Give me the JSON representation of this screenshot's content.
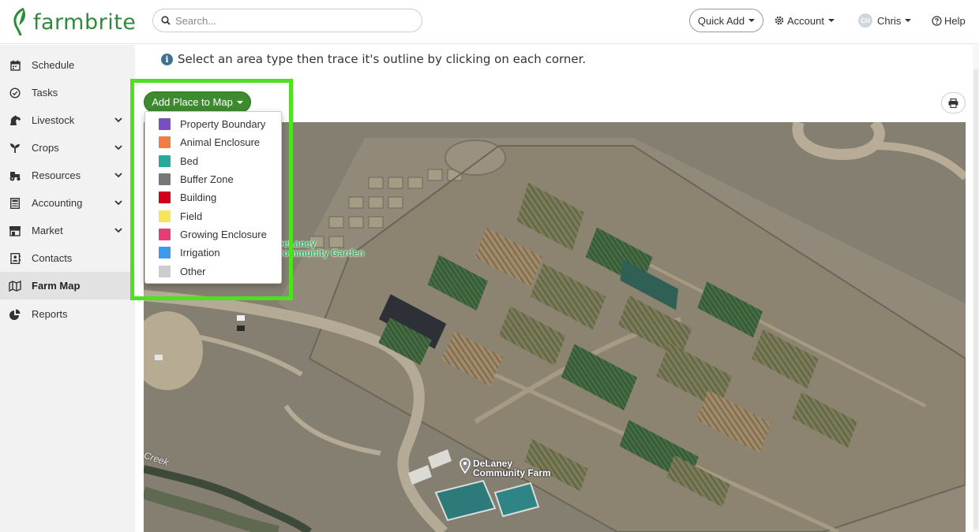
{
  "app": {
    "name": "farmbrite"
  },
  "header": {
    "search_placeholder": "Search...",
    "quick_add_label": "Quick Add",
    "account_label": "Account",
    "user_initials": "CH",
    "user_name": "Chris",
    "help_label": "Help"
  },
  "sidebar": {
    "items": [
      {
        "label": "Schedule",
        "icon": "calendar-icon",
        "expandable": false
      },
      {
        "label": "Tasks",
        "icon": "check-circle-icon",
        "expandable": false
      },
      {
        "label": "Livestock",
        "icon": "horse-icon",
        "expandable": true
      },
      {
        "label": "Crops",
        "icon": "seedling-icon",
        "expandable": true
      },
      {
        "label": "Resources",
        "icon": "tractor-icon",
        "expandable": true
      },
      {
        "label": "Accounting",
        "icon": "calculator-icon",
        "expandable": true
      },
      {
        "label": "Market",
        "icon": "store-icon",
        "expandable": true
      },
      {
        "label": "Contacts",
        "icon": "address-book-icon",
        "expandable": false
      },
      {
        "label": "Farm Map",
        "icon": "map-icon",
        "expandable": false,
        "active": true
      },
      {
        "label": "Reports",
        "icon": "pie-chart-icon",
        "expandable": false
      }
    ]
  },
  "main": {
    "instruction": "Select an area type then trace it's outline by clicking on each corner.",
    "add_place_label": "Add Place to Map",
    "area_types": [
      {
        "label": "Property Boundary",
        "color": "#7a4fc1"
      },
      {
        "label": "Animal Enclosure",
        "color": "#f07c4a"
      },
      {
        "label": "Bed",
        "color": "#2aa89a"
      },
      {
        "label": "Buffer Zone",
        "color": "#777777"
      },
      {
        "label": "Building",
        "color": "#d0021b"
      },
      {
        "label": "Field",
        "color": "#f8e45c"
      },
      {
        "label": "Growing Enclosure",
        "color": "#e63d77"
      },
      {
        "label": "Irrigation",
        "color": "#3d9be9"
      },
      {
        "label": "Other",
        "color": "#cccccc"
      }
    ],
    "map_labels": {
      "garden_line1": "DeLaney",
      "garden_line2": "Community Garden",
      "farm_line1": "DeLaney",
      "farm_line2": "Community Farm",
      "creek": "Creek"
    }
  },
  "colors": {
    "brand": "#2e8b3a",
    "button_green": "#3e8a2f",
    "highlight": "#4fe01f"
  }
}
